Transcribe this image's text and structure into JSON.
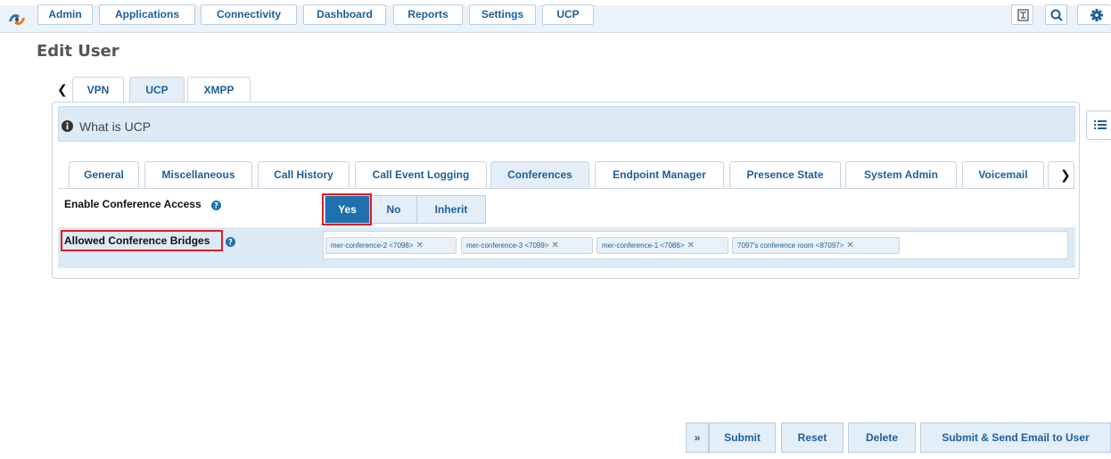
{
  "nav": {
    "items": [
      "Admin",
      "Applications",
      "Connectivity",
      "Dashboard",
      "Reports",
      "Settings",
      "UCP"
    ]
  },
  "page": {
    "title": "Edit User"
  },
  "user_tabs": [
    "VPN",
    "UCP",
    "XMPP"
  ],
  "info": {
    "text": "What is UCP"
  },
  "content_tabs": [
    "General",
    "Miscellaneous",
    "Call History",
    "Call Event Logging",
    "Conferences",
    "Endpoint Manager",
    "Presence State",
    "System Admin",
    "Voicemail"
  ],
  "conference_access": {
    "label": "Enable Conference Access",
    "options": [
      "Yes",
      "No",
      "Inherit"
    ],
    "selected": "Yes"
  },
  "bridges": {
    "label": "Allowed Conference Bridges",
    "tags": [
      "mer-conference-2 <7098>",
      "mer-conference-3 <7099>",
      "mer-conference-1 <7086>",
      "7097's conference room <87097>"
    ]
  },
  "footer": {
    "expand": "»",
    "submit": "Submit",
    "reset": "Reset",
    "delete": "Delete",
    "submit_email": "Submit & Send Email to User"
  },
  "colors": {
    "accent": "#1f70ad",
    "highlight": "#e01b24",
    "panel_bg": "#dceaf5"
  }
}
